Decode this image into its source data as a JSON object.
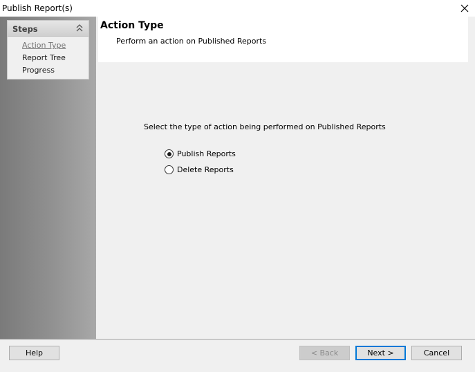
{
  "window": {
    "title": "Publish Report(s)"
  },
  "sidebar": {
    "header": "Steps",
    "items": [
      {
        "label": "Action Type",
        "current": true
      },
      {
        "label": "Report Tree",
        "current": false
      },
      {
        "label": "Progress",
        "current": false
      }
    ]
  },
  "header": {
    "title": "Action Type",
    "subtitle": "Perform an action on Published Reports"
  },
  "main": {
    "prompt": "Select the type of action being performed on Published Reports",
    "options": [
      {
        "label": "Publish Reports",
        "checked": true
      },
      {
        "label": "Delete Reports",
        "checked": false
      }
    ]
  },
  "footer": {
    "help_label": "Help",
    "back_label": "< Back",
    "next_label": "Next >",
    "cancel_label": "Cancel"
  }
}
